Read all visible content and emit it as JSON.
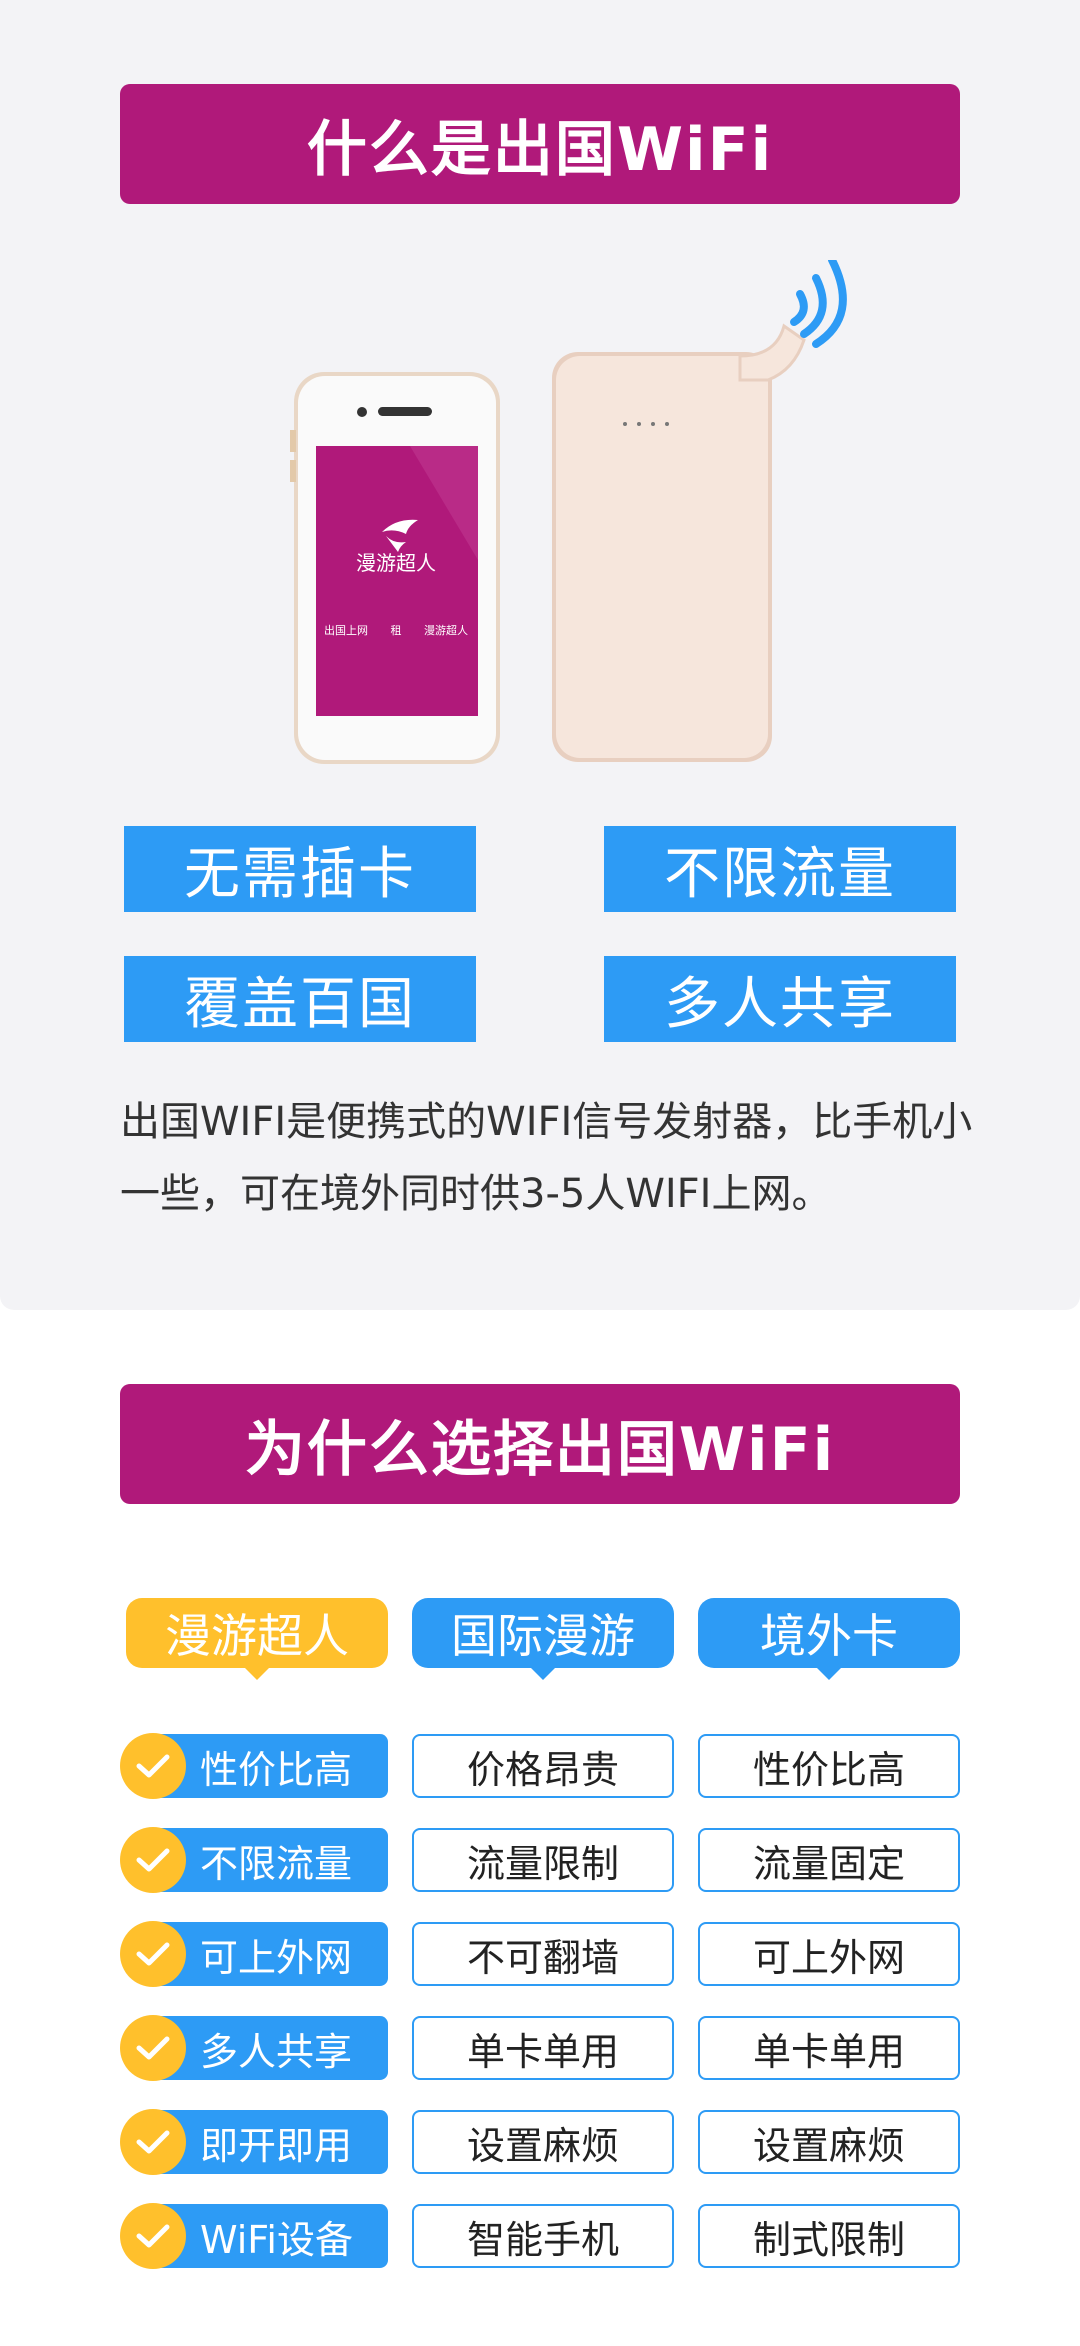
{
  "section1": {
    "title": "什么是出国WiFi",
    "phone_screen": {
      "brand": "漫游超人",
      "tagline_left": "出国上网",
      "tagline_mid": "租",
      "tagline_right": "漫游超人"
    },
    "features": [
      "无需插卡",
      "不限流量",
      "覆盖百国",
      "多人共享"
    ],
    "description": "出国WIFI是便携式的WIFI信号发射器，比手机小一些，可在境外同时供3-5人WIFI上网。"
  },
  "section2": {
    "title": "为什么选择出国WiFi",
    "columns": [
      {
        "label": "漫游超人",
        "color": "#ffc02c"
      },
      {
        "label": "国际漫游",
        "color": "#2d9bf5"
      },
      {
        "label": "境外卡",
        "color": "#2d9bf5"
      }
    ],
    "rows": [
      {
        "ours": "性价比高",
        "roaming": "价格昂贵",
        "local_card": "性价比高"
      },
      {
        "ours": "不限流量",
        "roaming": "流量限制",
        "local_card": "流量固定"
      },
      {
        "ours": "可上外网",
        "roaming": "不可翻墙",
        "local_card": "可上外网"
      },
      {
        "ours": "多人共享",
        "roaming": "单卡单用",
        "local_card": "单卡单用"
      },
      {
        "ours": "即开即用",
        "roaming": "设置麻烦",
        "local_card": "设置麻烦"
      },
      {
        "ours": "WiFi设备",
        "roaming": "智能手机",
        "local_card": "制式限制"
      }
    ]
  },
  "colors": {
    "banner": "#b0197a",
    "accent_blue": "#2d9bf5",
    "accent_yellow": "#ffc02c"
  }
}
